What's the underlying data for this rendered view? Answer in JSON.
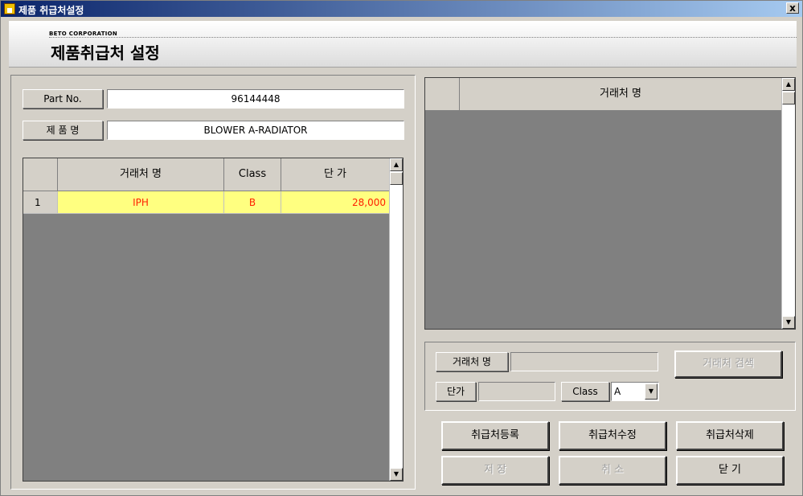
{
  "window": {
    "title": "제품 취급처설정",
    "close_glyph": "x"
  },
  "header": {
    "corp": "BETO CORPORATION",
    "title": "제품취급처 설정"
  },
  "product": {
    "part_no_label": "Part No.",
    "part_no_value": "96144448",
    "name_label": "제 품 명",
    "name_value": "BLOWER A-RADIATOR"
  },
  "supplier_grid": {
    "columns": [
      "거래처 명",
      "Class",
      "단 가"
    ],
    "rows": [
      {
        "num": "1",
        "vendor": "IPH",
        "class": "B",
        "price": "28,000"
      }
    ]
  },
  "vendor_list": {
    "column": "거래처 명"
  },
  "form": {
    "vendor_label": "거래처 명",
    "vendor_value": "",
    "search_button": "거래처 검색",
    "price_label": "단가",
    "price_value": "",
    "class_label": "Class",
    "class_value": "A"
  },
  "buttons": {
    "register": "취급처등록",
    "modify": "취급처수정",
    "delete": "취급처삭제",
    "save": "저 장",
    "cancel": "취 소",
    "close": "닫 기"
  }
}
